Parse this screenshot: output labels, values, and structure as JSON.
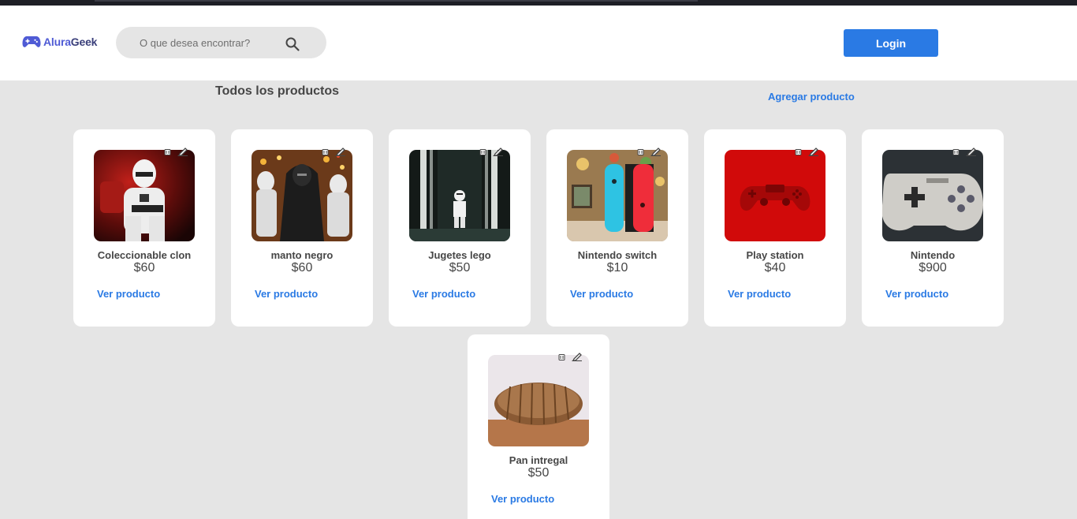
{
  "header": {
    "logo": {
      "part1": "Alura",
      "part2": "Geek",
      "icon": "gamepad-icon",
      "color": "#4f5bd5"
    },
    "search": {
      "placeholder": "O que desea encontrar?",
      "value": "",
      "icon": "search-icon"
    },
    "login_label": "Login"
  },
  "main": {
    "title": "Todos los productos",
    "add_product_label": "Agregar producto"
  },
  "products": [
    {
      "name": "Coleccionable clon",
      "price": "$60",
      "view_label": "Ver producto",
      "image": "stormtrooper-figure"
    },
    {
      "name": "manto negro",
      "price": "$60",
      "view_label": "Ver producto",
      "image": "kylo-ren-figure"
    },
    {
      "name": "Jugetes lego",
      "price": "$50",
      "view_label": "Ver producto",
      "image": "lego-stormtrooper"
    },
    {
      "name": "Nintendo switch",
      "price": "$10",
      "view_label": "Ver producto",
      "image": "nintendo-switch-console"
    },
    {
      "name": "Play station",
      "price": "$40",
      "view_label": "Ver producto",
      "image": "red-ps4-controller"
    },
    {
      "name": "Nintendo",
      "price": "$900",
      "view_label": "Ver producto",
      "image": "snes-controller"
    },
    {
      "name": "Pan intregal",
      "price": "$50",
      "view_label": "Ver producto",
      "image": "sliced-bread"
    }
  ],
  "colors": {
    "accent": "#2a7ae4",
    "background": "#e5e5e5",
    "text": "#464646"
  }
}
